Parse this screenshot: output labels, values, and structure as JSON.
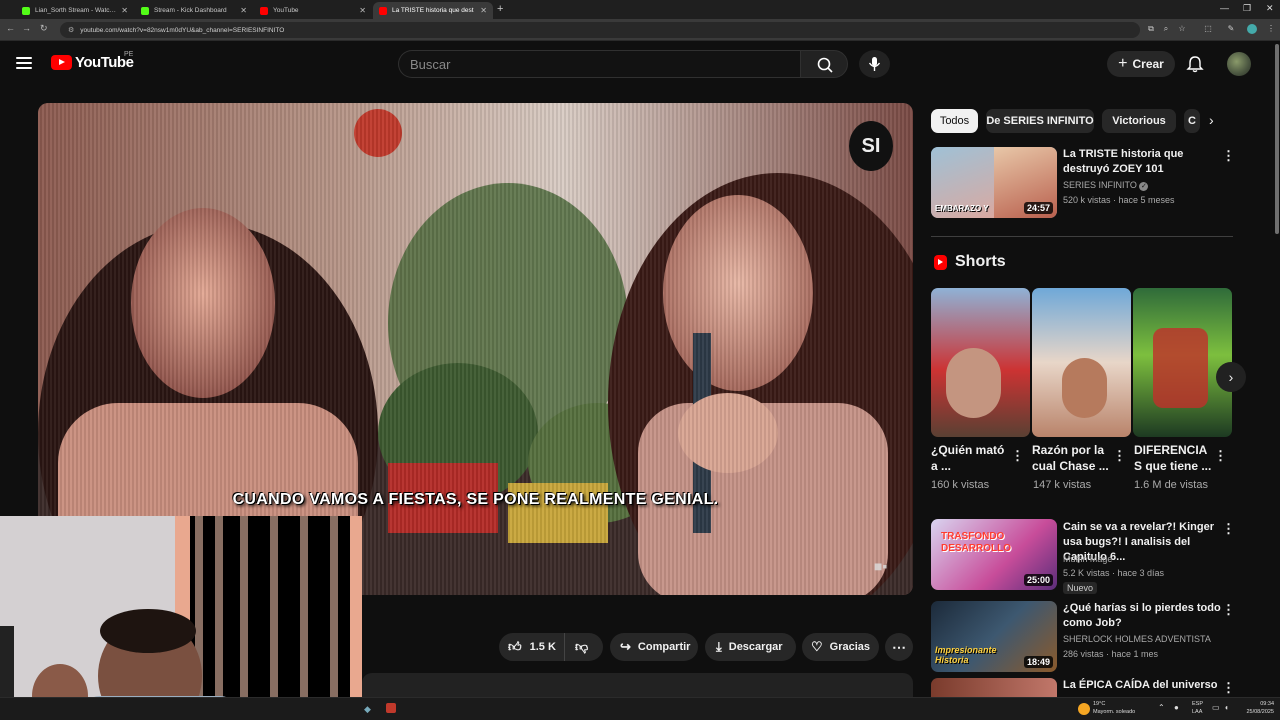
{
  "browser": {
    "tabs": [
      {
        "label": "Lian_Sorth Stream - Watch Live",
        "favicon_color": "#53fc18",
        "active": false
      },
      {
        "label": "Stream - Kick Dashboard",
        "favicon_color": "#53fc18",
        "active": false
      },
      {
        "label": "YouTube",
        "favicon_color": "#ff0000",
        "active": false
      },
      {
        "label": "La TRISTE historia que dest",
        "favicon_color": "#ff0000",
        "active": true
      }
    ],
    "new_tab_icon": "plus-icon",
    "url": "youtube.com/watch?v=82nsw1m0dYU&ab_channel=SERIESINFINITO"
  },
  "header": {
    "logo_text": "YouTube",
    "country_code": "PE",
    "search_placeholder": "Buscar",
    "create_label": "Crear"
  },
  "player": {
    "subtitle": "CUANDO VAMOS A FIESTAS, SE PONE REALMENTE GENIAL.",
    "watermark": "SI"
  },
  "actions": {
    "likes": "1.5 K",
    "share_label": "Compartir",
    "download_label": "Descargar",
    "thanks_label": "Gracias"
  },
  "chips": [
    "Todos",
    "De SERIES INFINITO",
    "Victorious",
    "C"
  ],
  "top_video": {
    "title": "La TRISTE historia que destruyó ZOEY 101",
    "channel": "SERIES INFINITO",
    "meta": "520 k vistas · hace 5 meses",
    "duration": "24:57",
    "thumb_text": "EMBARAZO Y"
  },
  "shorts": {
    "section_title": "Shorts",
    "items": [
      {
        "title": "¿Quién mató a ...",
        "views": "160 k vistas"
      },
      {
        "title": "Razón por la cual Chase ...",
        "views": "147 k vistas"
      },
      {
        "title": "DIFERENCIA S que tiene ...",
        "views": "1.6 M de vistas"
      }
    ]
  },
  "videos": [
    {
      "title": "Cain se va a revelar?! Kinger usa bugs?! I analisis del Capitulo 6...",
      "channel": "Muffin Mage",
      "meta": "5.2 K vistas · hace 3 días",
      "badge": "Nuevo",
      "duration": "25:00",
      "thumb_text": "TRASFONDO DESARROLLO"
    },
    {
      "title": "¿Qué harías si lo pierdes todo como Job?",
      "channel": "SHERLOCK HOLMES ADVENTISTA",
      "meta": "286 vistas · hace 1 mes",
      "duration": "18:49",
      "thumb_text": "Impresionante Historia"
    },
    {
      "title": "La ÉPICA CAÍDA del universo",
      "channel": "",
      "meta": ""
    }
  ],
  "taskbar": {
    "weather_temp": "19°C",
    "weather_desc": "Mayorm. soleado",
    "lang": "ESP",
    "lang_sub": "LAA",
    "time": "09:34",
    "date": "25/08/2025"
  }
}
